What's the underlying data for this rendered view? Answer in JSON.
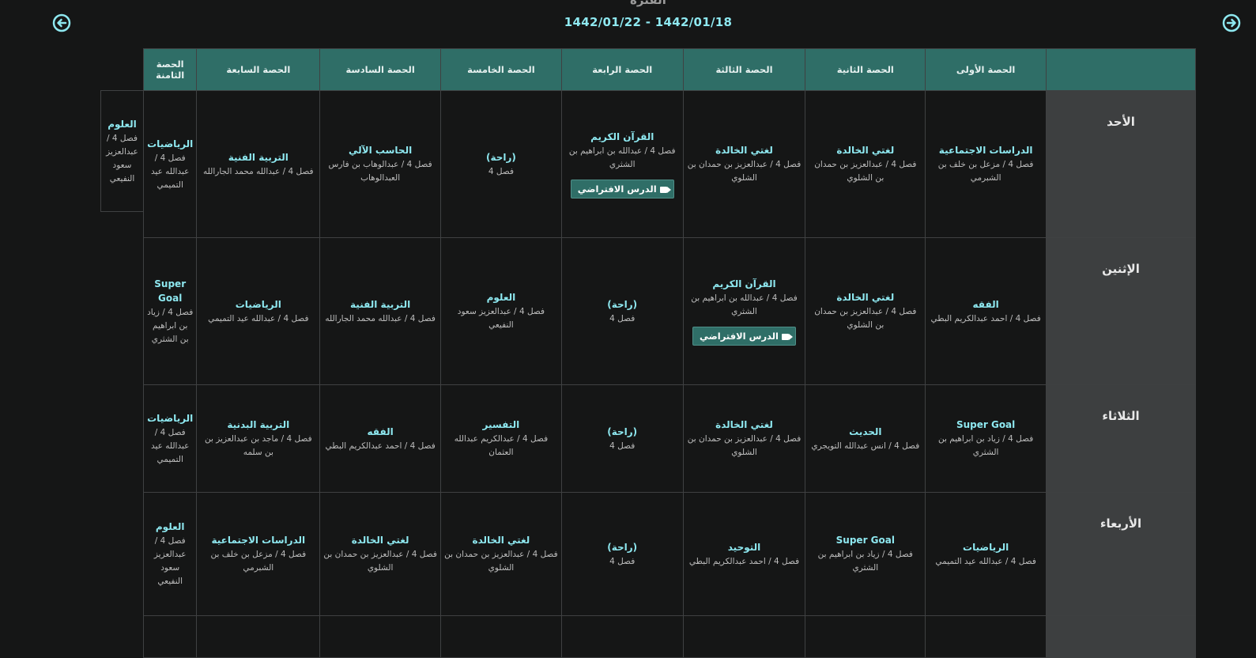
{
  "header": {
    "period_label": "الفترة",
    "date_range": "1442/01/22 - 1442/01/18"
  },
  "columns": [
    "",
    "الحصة الأولى",
    "الحصة الثانية",
    "الحصة الثالثة",
    "الحصة الرابعة",
    "الحصة الخامسة",
    "الحصة السادسة",
    "الحصة السابعة",
    "الحصة الثامنة"
  ],
  "virtual_button_label": "الدرس الافتراضي",
  "overflow_cell": {
    "subject": "العلوم",
    "info": "فصل 4 / عبدالعزيز سعود النفيعي"
  },
  "days": [
    {
      "name": "الأحد",
      "periods": [
        {
          "subject": "الدراسات الاجتماعية",
          "info": "فصل 4 / مزعل بن خلف بن الشبرمي",
          "virtual": false
        },
        {
          "subject": "لغتي الخالدة",
          "info": "فصل 4 / عبدالعزيز بن حمدان بن الشلوي",
          "virtual": false
        },
        {
          "subject": "لغتي الخالدة",
          "info": "فصل 4 / عبدالعزيز بن حمدان بن الشلوي",
          "virtual": false
        },
        {
          "subject": "القرآن الكريم",
          "info": "فصل 4 / عبدالله بن ابراهيم بن الشثري",
          "virtual": true
        },
        {
          "subject": "(راحة)",
          "info": "فصل 4",
          "virtual": false
        },
        {
          "subject": "الحاسب الآلي",
          "info": "فصل 4 / عبدالوهاب بن فارس العبدالوهاب",
          "virtual": false
        },
        {
          "subject": "التربية الفنية",
          "info": "فصل 4 / عبدالله محمد الجارالله",
          "virtual": false
        },
        {
          "subject": "الرياضيات",
          "info": "فصل 4 / عبدالله عيد التميمي",
          "virtual": false
        }
      ]
    },
    {
      "name": "الإثنين",
      "periods": [
        {
          "subject": "الفقه",
          "info": "فصل 4 / احمد عبدالكريم البطي",
          "virtual": false
        },
        {
          "subject": "لغتي الخالدة",
          "info": "فصل 4 / عبدالعزيز بن حمدان بن الشلوي",
          "virtual": false
        },
        {
          "subject": "القرآن الكريم",
          "info": "فصل 4 / عبدالله بن ابراهيم بن الشثري",
          "virtual": true
        },
        {
          "subject": "(راحة)",
          "info": "فصل 4",
          "virtual": false
        },
        {
          "subject": "العلوم",
          "info": "فصل 4 / عبدالعزيز سعود النفيعي",
          "virtual": false
        },
        {
          "subject": "التربية الفنية",
          "info": "فصل 4 / عبدالله محمد الجارالله",
          "virtual": false
        },
        {
          "subject": "الرياضيات",
          "info": "فصل 4 / عبدالله عيد التميمي",
          "virtual": false
        },
        {
          "subject": "Super Goal",
          "info": "فصل 4 / زياد بن ابراهيم بن الشثري",
          "virtual": false
        }
      ]
    },
    {
      "name": "الثلاثاء",
      "periods": [
        {
          "subject": "Super Goal",
          "info": "فصل 4 / زياد بن ابراهيم بن الشثري",
          "virtual": false
        },
        {
          "subject": "الحديث",
          "info": "فصل 4 / انس عبدالله التويجري",
          "virtual": false
        },
        {
          "subject": "لغتي الخالدة",
          "info": "فصل 4 / عبدالعزيز بن حمدان بن الشلوي",
          "virtual": false
        },
        {
          "subject": "(راحة)",
          "info": "فصل 4",
          "virtual": false
        },
        {
          "subject": "التفسير",
          "info": "فصل 4 / عبدالكريم عبدالله العثمان",
          "virtual": false
        },
        {
          "subject": "الفقه",
          "info": "فصل 4 / احمد عبدالكريم البطي",
          "virtual": false
        },
        {
          "subject": "التربية البدنية",
          "info": "فصل 4 / ماجد بن عبدالعزيز بن بن سلمه",
          "virtual": false
        },
        {
          "subject": "الرياضيات",
          "info": "فصل 4 / عبدالله عيد التميمي",
          "virtual": false
        }
      ]
    },
    {
      "name": "الأربعاء",
      "periods": [
        {
          "subject": "الرياضيات",
          "info": "فصل 4 / عبدالله عيد التميمي",
          "virtual": false
        },
        {
          "subject": "Super Goal",
          "info": "فصل 4 / زياد بن ابراهيم بن الشثري",
          "virtual": false
        },
        {
          "subject": "التوحيد",
          "info": "فصل 4 / احمد عبدالكريم البطي",
          "virtual": false
        },
        {
          "subject": "(راحة)",
          "info": "فصل 4",
          "virtual": false
        },
        {
          "subject": "لغتي الخالدة",
          "info": "فصل 4 / عبدالعزيز بن حمدان بن الشلوي",
          "virtual": false
        },
        {
          "subject": "لغتي الخالدة",
          "info": "فصل 4 / عبدالعزيز بن حمدان بن الشلوي",
          "virtual": false
        },
        {
          "subject": "الدراسات الاجتماعية",
          "info": "فصل 4 / مزعل بن خلف بن الشبرمي",
          "virtual": false
        },
        {
          "subject": "العلوم",
          "info": "فصل 4 / عبدالعزيز سعود النفيعي",
          "virtual": false
        }
      ]
    }
  ],
  "icons": {
    "prev": "arrow-circle-left-icon",
    "next": "arrow-circle-right-icon",
    "virtual": "video-camera-icon"
  },
  "colors": {
    "accent": "#2f6e67",
    "subject_text": "#8ee8f0",
    "background": "#151616"
  }
}
